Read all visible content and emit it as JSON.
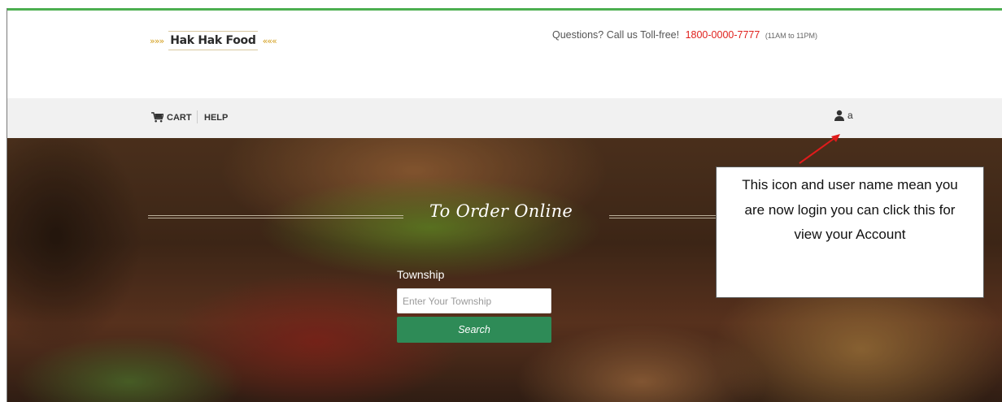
{
  "header": {
    "brand": "Hak Hak Food",
    "wheat_left": "»»»",
    "wheat_right": "«««",
    "contact_text": "Questions? Call us Toll-free!",
    "phone": "1800-0000-7777",
    "hours": "(11AM to 11PM)"
  },
  "nav": {
    "cart_label": "CART",
    "help_label": "HELP",
    "username": "a"
  },
  "hero": {
    "title": "To Order Online",
    "township_label": "Township",
    "township_placeholder": "Enter Your Township",
    "township_value": "",
    "search_label": "Search"
  },
  "annotation": {
    "text": "This icon and user name mean you are now login you can click this for view your Account"
  },
  "colors": {
    "accent_green": "#4caf50",
    "button_green": "#2e8b57",
    "phone_red": "#e0211d",
    "arrow_red": "#e01b1b"
  }
}
